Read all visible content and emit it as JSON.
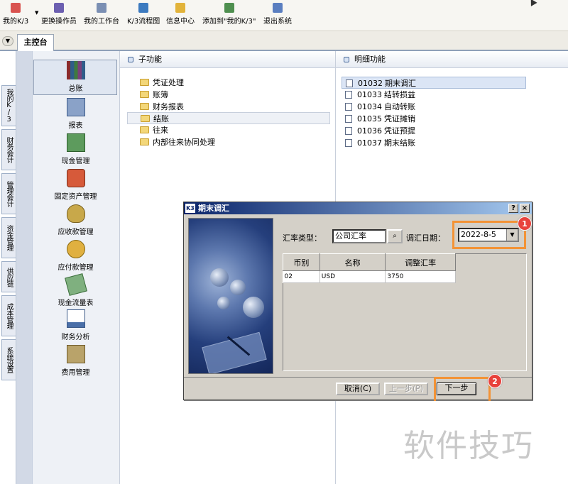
{
  "toolbar": {
    "items": [
      {
        "label": "我的K/3",
        "icon": "star-icon",
        "color": "#d9534f"
      },
      {
        "label": "更换操作员",
        "icon": "users-icon",
        "color": "#6c5fb0"
      },
      {
        "label": "我的工作台",
        "icon": "pencil-icon",
        "color": "#7b8fb3"
      },
      {
        "label": "K/3流程图",
        "icon": "flowchart-icon",
        "color": "#3c7abf"
      },
      {
        "label": "信息中心",
        "icon": "message-icon",
        "color": "#e2b33a"
      },
      {
        "label": "添加到\"我的K/3\"",
        "icon": "add-favorite-icon",
        "color": "#4f8f4f"
      },
      {
        "label": "退出系统",
        "icon": "exit-icon",
        "color": "#5a7ec0"
      }
    ]
  },
  "tabs": {
    "main": "主控台"
  },
  "vtabs": [
    "我的K/3",
    "财务会计",
    "管理会计",
    "资金管理",
    "供应链",
    "成本管理",
    "系统设置"
  ],
  "modules": [
    {
      "label": "总账",
      "icon": "ledger-books-icon",
      "selected": true
    },
    {
      "label": "报表",
      "icon": "report-icon"
    },
    {
      "label": "现金管理",
      "icon": "cash-icon"
    },
    {
      "label": "固定资产管理",
      "icon": "truck-icon"
    },
    {
      "label": "应收款管理",
      "icon": "money-bag-icon"
    },
    {
      "label": "应付款管理",
      "icon": "coins-icon"
    },
    {
      "label": "现金流量表",
      "icon": "cashflow-icon"
    },
    {
      "label": "财务分析",
      "icon": "analysis-chart-icon"
    },
    {
      "label": "费用管理",
      "icon": "expense-icon"
    }
  ],
  "subfunctions": {
    "title": "子功能",
    "items": [
      "凭证处理",
      "账簿",
      "财务报表",
      "结账",
      "往来",
      "内部往来协同处理"
    ],
    "selected": "结账"
  },
  "details": {
    "title": "明细功能",
    "items": [
      {
        "code": "01032",
        "label": "期末调汇"
      },
      {
        "code": "01033",
        "label": "结转损益"
      },
      {
        "code": "01034",
        "label": "自动转账"
      },
      {
        "code": "01035",
        "label": "凭证摊销"
      },
      {
        "code": "01036",
        "label": "凭证预提"
      },
      {
        "code": "01037",
        "label": "期末结账"
      }
    ]
  },
  "dialog": {
    "title": "期末调汇",
    "help": "?",
    "close": "×",
    "rate_type_label": "汇率类型：",
    "rate_type_value": "公司汇率",
    "date_label": "调汇日期：",
    "date_value": "2022-8-5",
    "grid_headers": [
      "币别",
      "名称",
      "调整汇率"
    ],
    "grid_rows": [
      [
        "02",
        "USD",
        "3750"
      ]
    ],
    "buttons": {
      "cancel": "取消(C)",
      "prev": "上一步(P)",
      "next": "下一步"
    },
    "badges": [
      "1",
      "2"
    ],
    "highlight_color": "#f39336"
  },
  "watermark": "软件技巧"
}
